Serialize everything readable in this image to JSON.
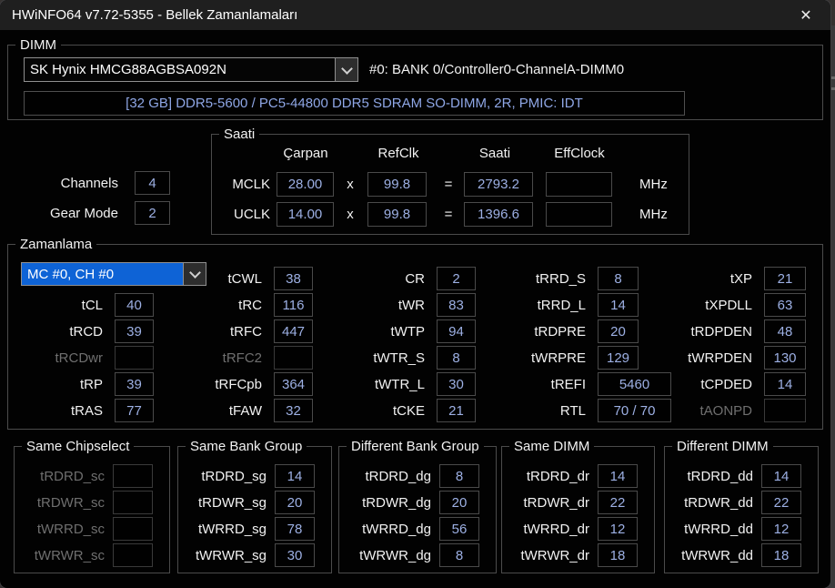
{
  "colors": {
    "value_text": "#9db0e4",
    "info_text": "#8fa7e6",
    "selection": "#0e63d6",
    "titlebar": "#1f1f1f"
  },
  "window": {
    "title": "HWiNFO64 v7.72-5355 - Bellek Zamanlamaları",
    "close_icon": "✕"
  },
  "dimm": {
    "group_label": "DIMM",
    "selector_value": "SK Hynix HMCG88AGBSA092N",
    "slot_label": "#0: BANK 0/Controller0-ChannelA-DIMM0",
    "module_info": "[32 GB] DDR5-5600 / PC5-44800 DDR5 SDRAM SO-DIMM, 2R, PMIC: IDT"
  },
  "channels": {
    "label": "Channels",
    "value": "4"
  },
  "gear_mode": {
    "label": "Gear Mode",
    "value": "2"
  },
  "clocks": {
    "group_label": "Saati",
    "headers": {
      "multiplier": "Çarpan",
      "refclk": "RefClk",
      "clock": "Saati",
      "effclock": "EffClock"
    },
    "times_sign": "x",
    "equals_sign": "=",
    "mclk": {
      "label": "MCLK",
      "multiplier": "28.00",
      "refclk": "99.8",
      "clock": "2793.2",
      "effclock": "",
      "unit": "MHz"
    },
    "uclk": {
      "label": "UCLK",
      "multiplier": "14.00",
      "refclk": "99.8",
      "clock": "1396.6",
      "effclock": "",
      "unit": "MHz"
    }
  },
  "timings": {
    "group_label": "Zamanlama",
    "selector_value": "MC #0, CH #0",
    "col1": [
      {
        "label": "tCL",
        "value": "40"
      },
      {
        "label": "tRCD",
        "value": "39"
      },
      {
        "label": "tRCDwr",
        "value": ""
      },
      {
        "label": "tRP",
        "value": "39"
      },
      {
        "label": "tRAS",
        "value": "77"
      }
    ],
    "col2": [
      {
        "label": "tCWL",
        "value": "38"
      },
      {
        "label": "tRC",
        "value": "116"
      },
      {
        "label": "tRFC",
        "value": "447"
      },
      {
        "label": "tRFC2",
        "value": ""
      },
      {
        "label": "tRFCpb",
        "value": "364"
      },
      {
        "label": "tFAW",
        "value": "32"
      }
    ],
    "col3": [
      {
        "label": "CR",
        "value": "2"
      },
      {
        "label": "tWR",
        "value": "83"
      },
      {
        "label": "tWTP",
        "value": "94"
      },
      {
        "label": "tWTR_S",
        "value": "8"
      },
      {
        "label": "tWTR_L",
        "value": "30"
      },
      {
        "label": "tCKE",
        "value": "21"
      }
    ],
    "col4": [
      {
        "label": "tRRD_S",
        "value": "8"
      },
      {
        "label": "tRRD_L",
        "value": "14"
      },
      {
        "label": "tRDPRE",
        "value": "20"
      },
      {
        "label": "tWRPRE",
        "value": "129"
      },
      {
        "label": "tREFI",
        "value": "5460"
      },
      {
        "label": "RTL",
        "value": "70 / 70"
      }
    ],
    "col5": [
      {
        "label": "tXP",
        "value": "21"
      },
      {
        "label": "tXPDLL",
        "value": "63"
      },
      {
        "label": "tRDPDEN",
        "value": "48"
      },
      {
        "label": "tWRPDEN",
        "value": "130"
      },
      {
        "label": "tCPDED",
        "value": "14"
      },
      {
        "label": "tAONPD",
        "value": ""
      }
    ]
  },
  "bottom_groups": [
    {
      "title": "Same Chipselect",
      "items": [
        {
          "label": "tRDRD_sc",
          "value": ""
        },
        {
          "label": "tRDWR_sc",
          "value": ""
        },
        {
          "label": "tWRRD_sc",
          "value": ""
        },
        {
          "label": "tWRWR_sc",
          "value": ""
        }
      ]
    },
    {
      "title": "Same Bank Group",
      "items": [
        {
          "label": "tRDRD_sg",
          "value": "14"
        },
        {
          "label": "tRDWR_sg",
          "value": "20"
        },
        {
          "label": "tWRRD_sg",
          "value": "78"
        },
        {
          "label": "tWRWR_sg",
          "value": "30"
        }
      ]
    },
    {
      "title": "Different Bank Group",
      "items": [
        {
          "label": "tRDRD_dg",
          "value": "8"
        },
        {
          "label": "tRDWR_dg",
          "value": "20"
        },
        {
          "label": "tWRRD_dg",
          "value": "56"
        },
        {
          "label": "tWRWR_dg",
          "value": "8"
        }
      ]
    },
    {
      "title": "Same DIMM",
      "items": [
        {
          "label": "tRDRD_dr",
          "value": "14"
        },
        {
          "label": "tRDWR_dr",
          "value": "22"
        },
        {
          "label": "tWRRD_dr",
          "value": "12"
        },
        {
          "label": "tWRWR_dr",
          "value": "18"
        }
      ]
    },
    {
      "title": "Different DIMM",
      "items": [
        {
          "label": "tRDRD_dd",
          "value": "14"
        },
        {
          "label": "tRDWR_dd",
          "value": "22"
        },
        {
          "label": "tWRRD_dd",
          "value": "12"
        },
        {
          "label": "tWRWR_dd",
          "value": "18"
        }
      ]
    }
  ]
}
